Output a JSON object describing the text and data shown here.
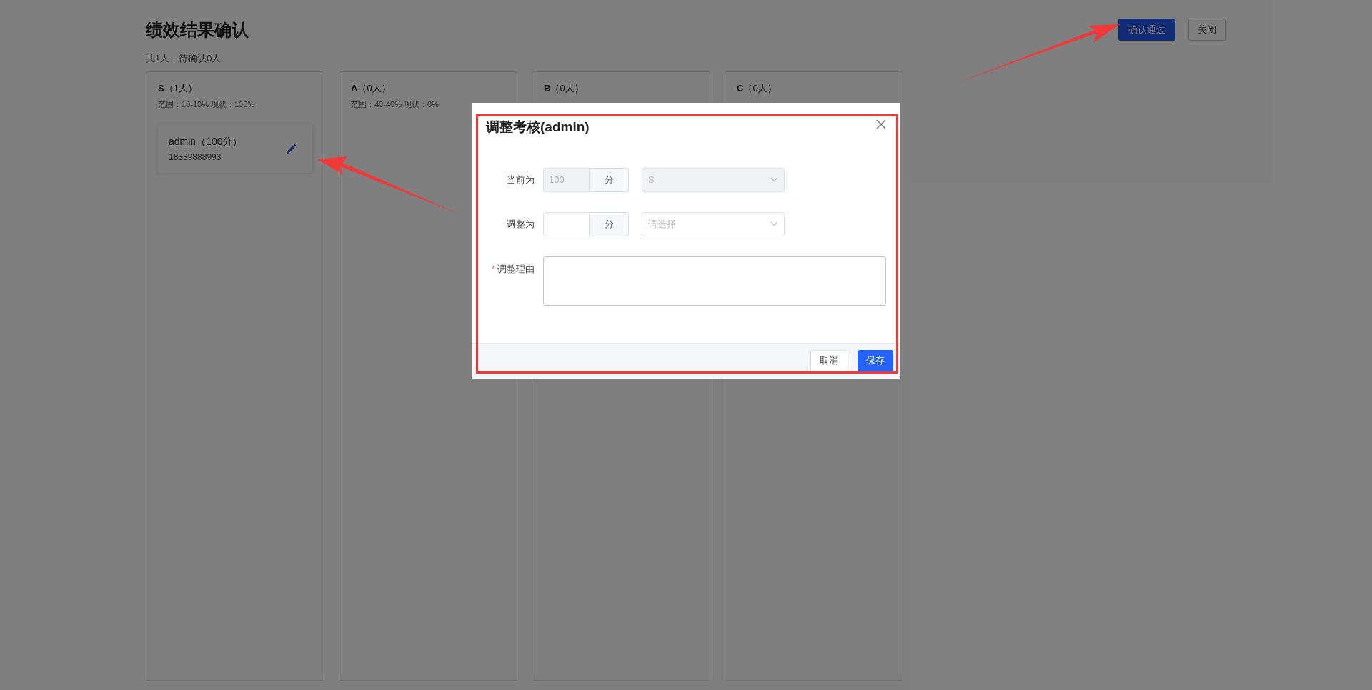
{
  "page": {
    "title": "绩效结果确认",
    "summary": "共1人，待确认0人",
    "actions": [
      {
        "label": "确认通过",
        "kind": "primary"
      },
      {
        "label": "关闭",
        "kind": "default"
      }
    ]
  },
  "columns": [
    {
      "grade": "S",
      "count": "（1人）",
      "range": "范围：10-10% 现状：100%",
      "people": [
        {
          "name": "admin（100分）",
          "phone": "18339888993"
        }
      ]
    },
    {
      "grade": "A",
      "count": "（0人）",
      "range": "范围：40-40% 现状：0%"
    },
    {
      "grade": "B",
      "count": "（0人）"
    },
    {
      "grade": "C",
      "count": "（0人）"
    }
  ],
  "dialog": {
    "title": "调整考核(admin)",
    "rows": [
      {
        "label": "当前为",
        "score_value": "100",
        "unit": "分",
        "grade_value": "S",
        "disabled": true
      },
      {
        "label": "调整为",
        "unit": "分",
        "grade_placeholder": "请选择",
        "disabled": false
      }
    ],
    "reason": {
      "label": "调整理由",
      "required_mark": "*"
    },
    "buttons": [
      {
        "label": "取消",
        "kind": "default"
      },
      {
        "label": "保存",
        "kind": "primary"
      }
    ]
  }
}
